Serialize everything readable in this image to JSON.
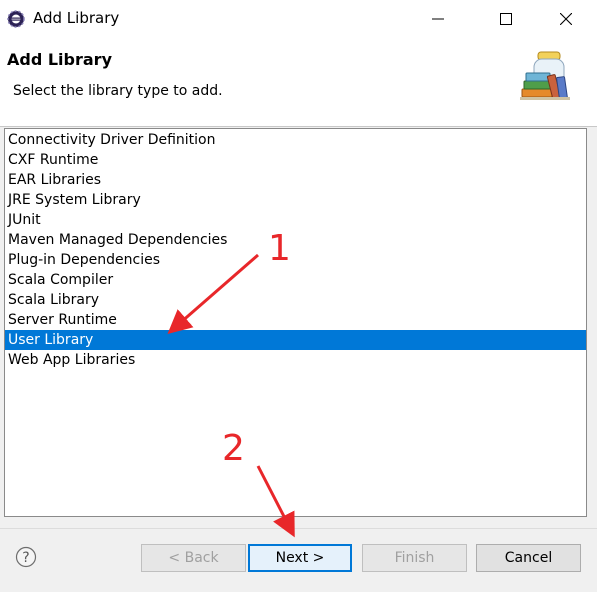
{
  "window": {
    "title": "Add Library",
    "app_icon": "eclipse-icon",
    "controls": {
      "minimize": "minimize-icon",
      "maximize": "maximize-icon",
      "close": "close-icon"
    }
  },
  "header": {
    "title": "Add Library",
    "description": "Select the library type to add.",
    "icon": "library-books-icon"
  },
  "library_types": {
    "selected": "User Library",
    "items": [
      "Connectivity Driver Definition",
      "CXF Runtime",
      "EAR Libraries",
      "JRE System Library",
      "JUnit",
      "Maven Managed Dependencies",
      "Plug-in Dependencies",
      "Scala Compiler",
      "Scala Library",
      "Server Runtime",
      "User Library",
      "Web App Libraries"
    ]
  },
  "buttons": {
    "help_icon": "help-icon",
    "back": "< Back",
    "next": "Next >",
    "finish": "Finish",
    "cancel": "Cancel"
  },
  "annotations": {
    "step1": "1",
    "step2": "2",
    "color": "#e8272a"
  },
  "colors": {
    "selection": "#0078d7",
    "default_button_border": "#0078d7"
  }
}
